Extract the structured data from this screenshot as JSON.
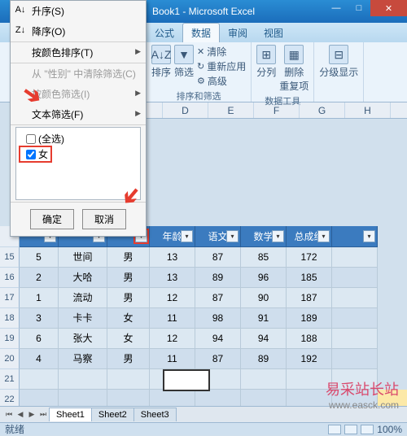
{
  "window": {
    "title": "Book1 - Microsoft Excel"
  },
  "tabs": {
    "formulas": "公式",
    "data": "数据",
    "review": "审阅",
    "view": "视图"
  },
  "ribbon": {
    "sort_label": "排序",
    "filter_label": "筛选",
    "clear": "清除",
    "reapply": "重新应用",
    "advanced": "高级",
    "text_to_cols": "分列",
    "remove_dup": "删除\n重复项",
    "group_show": "分级显示",
    "group1": "排序和筛选",
    "group2": "数据工具"
  },
  "cols": [
    "D",
    "E",
    "F",
    "G",
    "H"
  ],
  "filter_hdr": {
    "age": "年龄",
    "chinese": "语文",
    "math": "数学",
    "total": "总成绩"
  },
  "rows": [
    {
      "n": "15",
      "a": "5",
      "b": "世间",
      "c": "男",
      "d": "13",
      "e": "87",
      "f": "85",
      "g": "172"
    },
    {
      "n": "16",
      "a": "2",
      "b": "大哈",
      "c": "男",
      "d": "13",
      "e": "89",
      "f": "96",
      "g": "185"
    },
    {
      "n": "17",
      "a": "1",
      "b": "流动",
      "c": "男",
      "d": "12",
      "e": "87",
      "f": "90",
      "g": "187"
    },
    {
      "n": "18",
      "a": "3",
      "b": "卡卡",
      "c": "女",
      "d": "11",
      "e": "98",
      "f": "91",
      "g": "189"
    },
    {
      "n": "19",
      "a": "6",
      "b": "张大",
      "c": "女",
      "d": "12",
      "e": "94",
      "f": "94",
      "g": "188"
    },
    {
      "n": "20",
      "a": "4",
      "b": "马察",
      "c": "男",
      "d": "11",
      "e": "87",
      "f": "89",
      "g": "192"
    }
  ],
  "extra_rows": [
    "21",
    "22"
  ],
  "sort_menu": {
    "asc": "升序(S)",
    "desc": "降序(O)",
    "by_color": "按颜色排序(T)",
    "clear_filter": "从 \"性别\" 中清除筛选(C)",
    "filter_color": "按颜色筛选(I)",
    "text_filter": "文本筛选(F)",
    "select_all": "(全选)",
    "opt_female": "女",
    "ok": "确定",
    "cancel": "取消"
  },
  "sheets": {
    "s1": "Sheet1",
    "s2": "Sheet2",
    "s3": "Sheet3"
  },
  "status": {
    "ready": "就绪",
    "zoom": "100%"
  },
  "watermark": {
    "line1": "易采站长站",
    "line2": "www.easck.com"
  }
}
